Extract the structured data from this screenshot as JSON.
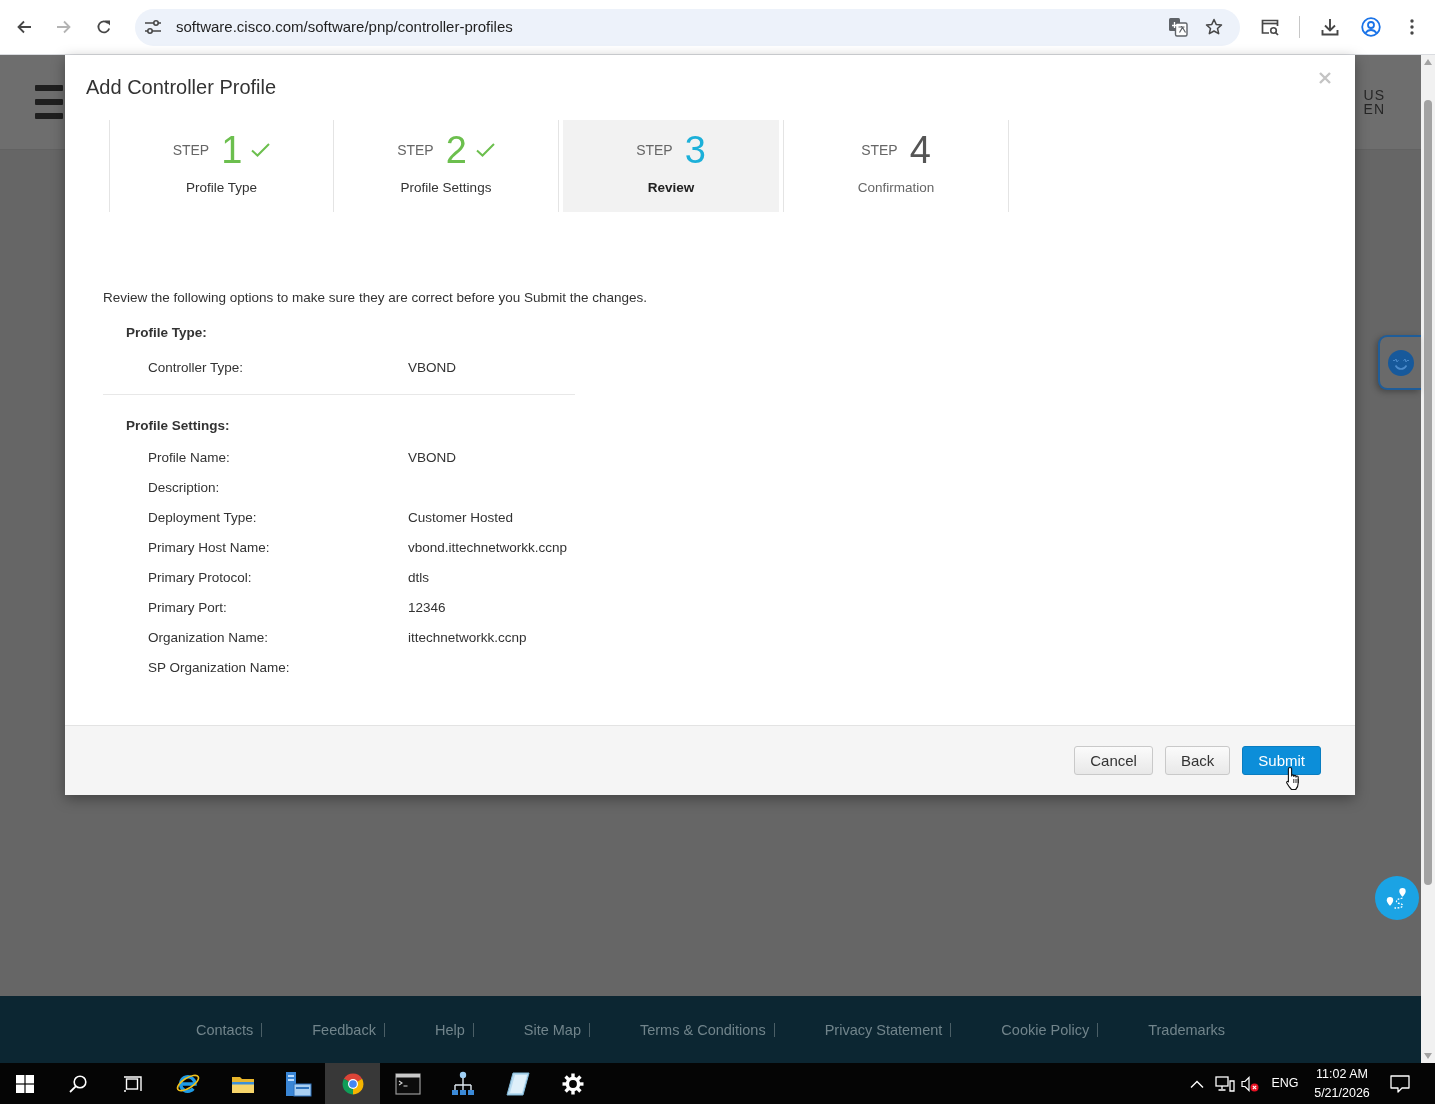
{
  "browser": {
    "url": "software.cisco.com/software/pnp/controller-profiles",
    "forward_enabled": false
  },
  "page_header": {
    "locale": [
      "US",
      "EN"
    ]
  },
  "dialog": {
    "title": "Add Controller Profile",
    "steps": [
      {
        "label": "STEP",
        "number": "1",
        "name": "Profile Type",
        "completed": true,
        "selected": false
      },
      {
        "label": "STEP",
        "number": "2",
        "name": "Profile Settings",
        "completed": true,
        "selected": false
      },
      {
        "label": "STEP",
        "number": "3",
        "name": "Review",
        "completed": false,
        "selected": true
      },
      {
        "label": "STEP",
        "number": "4",
        "name": "Confirmation",
        "completed": false,
        "selected": false
      }
    ],
    "intro": "Review the following options to make sure they are correct before you Submit the changes.",
    "sections": [
      {
        "heading": "Profile Type:",
        "fields": [
          {
            "label": "Controller Type:",
            "value": "VBOND"
          }
        ]
      },
      {
        "heading": "Profile Settings:",
        "fields": [
          {
            "label": "Profile Name:",
            "value": "VBOND"
          },
          {
            "label": "Description:"
          },
          {
            "label": "Deployment Type:",
            "value": "Customer Hosted"
          },
          {
            "label": "Primary Host Name:",
            "value": "vbond.ittechnetworkk.ccnp"
          },
          {
            "label": "Primary Protocol:",
            "value": "dtls"
          },
          {
            "label": "Primary Port:",
            "value": "12346"
          },
          {
            "label": "Organization Name:",
            "value": "ittechnetworkk.ccnp"
          },
          {
            "label": "SP Organization Name:"
          }
        ]
      }
    ],
    "buttons": [
      {
        "label": "Cancel",
        "kind": "secondary"
      },
      {
        "label": "Back",
        "kind": "secondary"
      },
      {
        "label": "Submit",
        "kind": "primary"
      }
    ]
  },
  "footer": {
    "links": [
      "Contacts",
      "Feedback",
      "Help",
      "Site Map",
      "Terms & Conditions",
      "Privacy Statement",
      "Cookie Policy",
      "Trademarks"
    ]
  },
  "taskbar": {
    "apps": [
      {
        "kind": "ebrowser",
        "selected": false
      },
      {
        "kind": "folder",
        "selected": false
      },
      {
        "kind": "server",
        "selected": false
      },
      {
        "kind": "browser",
        "selected": true
      },
      {
        "kind": "terminal",
        "selected": false
      },
      {
        "kind": "network",
        "selected": false
      },
      {
        "kind": "tablet",
        "selected": false
      },
      {
        "kind": "settings",
        "selected": false
      }
    ],
    "language": "ENG",
    "time": "11:02 AM",
    "date": "5/21/2026"
  }
}
